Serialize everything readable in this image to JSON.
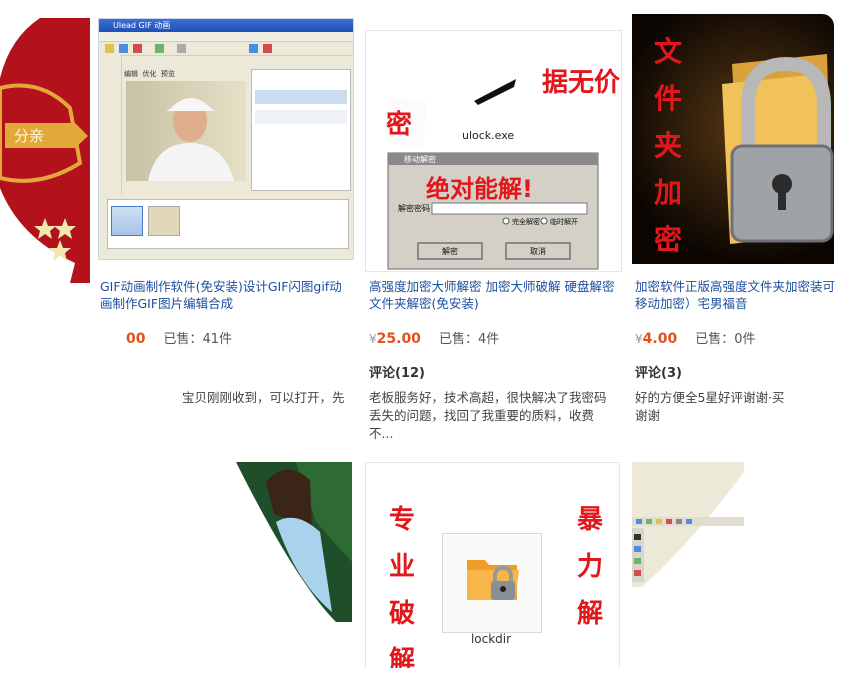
{
  "products": [
    {
      "title": "GIF动画制作软件(免安装)设计GIF闪图gif动画制作GIF图片编辑合成",
      "price": "00",
      "sold": "已售：41件",
      "comment": "宝贝刚刚收到，可以打开，先",
      "thumb_text": "分亲"
    },
    {
      "title": "高强度加密大师解密 加密大师破解 硬盘解密文件夹解密(免安装)",
      "currency": "¥",
      "price": "25.00",
      "sold": "已售：4件",
      "reviews": "评论(12)",
      "comment": "老板服务好，技术高超，很快解决了我密码丢失的问题，找回了我重要的质料，收费不...",
      "thumb": {
        "exe_label": "ulock.exe",
        "dialog_title": "移动解密",
        "big_text": "绝对能解!",
        "field_label": "解密密码",
        "radio1": "完全解密",
        "radio2": "临时解开",
        "btn_ok": "解密",
        "btn_cancel": "取消",
        "top_text": "据无价!",
        "left_text": "密"
      }
    },
    {
      "title": "加密软件正版高强度文件夹加密装可移动加密）宅男福音",
      "currency": "¥",
      "price": "4.00",
      "sold": "已售：0件",
      "reviews": "评论(3)",
      "comment": "好的方便全5星好评谢谢·买谢谢",
      "thumb_chars": [
        "文",
        "件",
        "夹",
        "加",
        "密"
      ]
    }
  ],
  "row2": {
    "lockdir_label": "lockdir",
    "left_chars": [
      "专",
      "业",
      "破",
      "解"
    ],
    "right_chars": [
      "暴",
      "力",
      "解"
    ]
  },
  "gif_app": {
    "window_title": "Ulead GIF 动画",
    "tab1": "编辑",
    "tab2": "优化",
    "tab3": "预览"
  },
  "colors": {
    "link": "#1c4fa0",
    "price": "#e4501a",
    "red_text": "#e3171b"
  }
}
